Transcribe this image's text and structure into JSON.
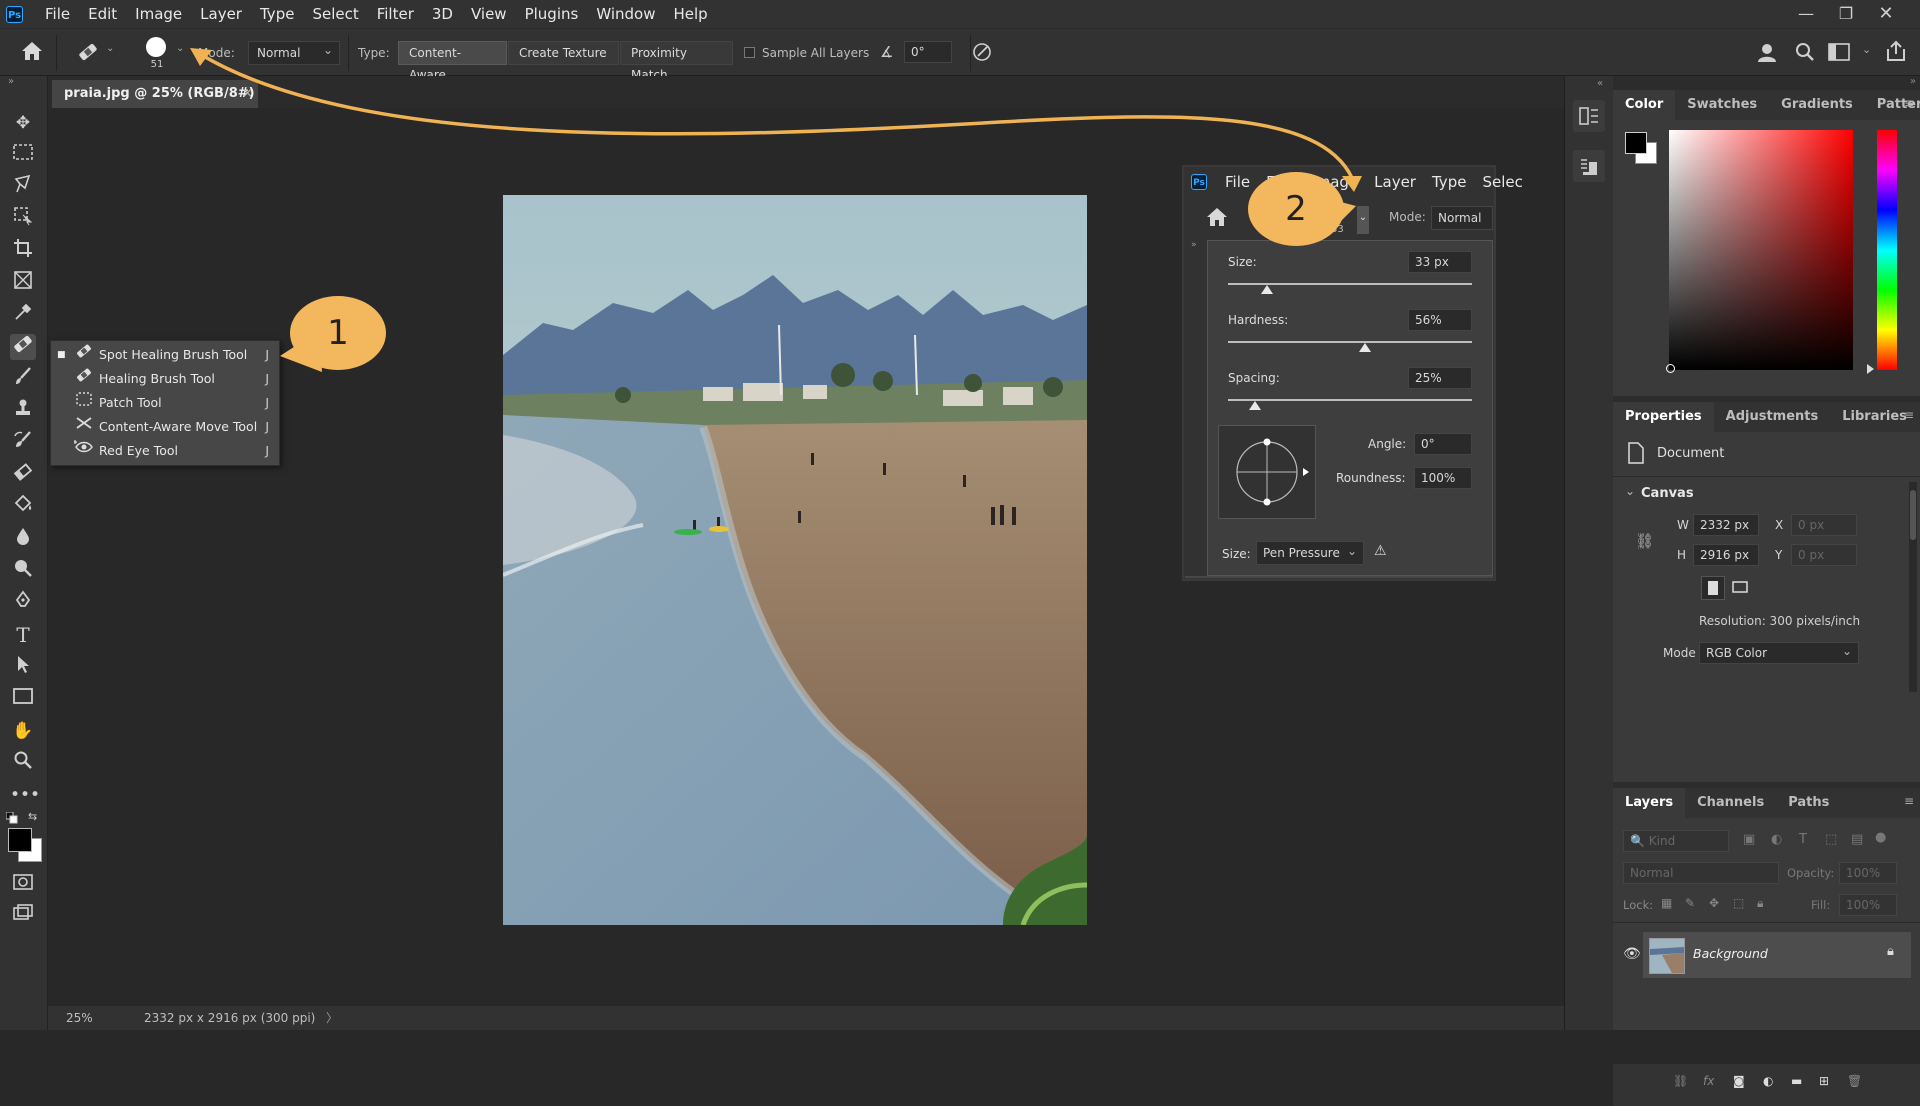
{
  "menubar": {
    "logo": "Ps",
    "items": [
      "File",
      "Edit",
      "Image",
      "Layer",
      "Type",
      "Select",
      "Filter",
      "3D",
      "View",
      "Plugins",
      "Window",
      "Help"
    ]
  },
  "options": {
    "brush_size": "51",
    "mode_label": "Mode:",
    "mode_value": "Normal",
    "type_label": "Type:",
    "type_buttons": [
      "Content-Aware",
      "Create Texture",
      "Proximity Match"
    ],
    "sample_all_layers": "Sample All Layers",
    "angle_value": "0°"
  },
  "document": {
    "tab_title": "praia.jpg @ 25% (RGB/8#)",
    "zoom": "25%",
    "info": "2332 px x 2916 px (300 ppi)"
  },
  "flyout": [
    {
      "label": "Spot Healing Brush Tool",
      "shortcut": "J",
      "icon": "spot-healing-brush-icon"
    },
    {
      "label": "Healing Brush Tool",
      "shortcut": "J",
      "icon": "healing-brush-icon"
    },
    {
      "label": "Patch Tool",
      "shortcut": "J",
      "icon": "patch-icon"
    },
    {
      "label": "Content-Aware Move Tool",
      "shortcut": "J",
      "icon": "content-aware-move-icon"
    },
    {
      "label": "Red Eye Tool",
      "shortcut": "J",
      "icon": "red-eye-icon"
    }
  ],
  "callouts": {
    "one": "1",
    "two": "2"
  },
  "inset": {
    "menu": [
      "File",
      "Edit",
      "Image",
      "Layer",
      "Type",
      "Selec"
    ],
    "size_small": "33",
    "mode_label": "Mode:",
    "mode_value": "Normal",
    "size_label": "Size:",
    "size_value": "33 px",
    "hardness_label": "Hardness:",
    "hardness_value": "56%",
    "spacing_label": "Spacing:",
    "spacing_value": "25%",
    "angle_label": "Angle:",
    "angle_value": "0°",
    "roundness_label": "Roundness:",
    "roundness_value": "100%",
    "pen_label": "Size:",
    "pen_value": "Pen Pressure",
    "size_level": 0.16,
    "hardness_level": 0.56,
    "spacing_level": 0.11
  },
  "color_panel": {
    "tabs": [
      "Color",
      "Swatches",
      "Gradients",
      "Patterns"
    ],
    "foreground": "#000000",
    "background": "#ffffff",
    "hue_color": "#ff0000"
  },
  "properties": {
    "tabs": [
      "Properties",
      "Adjustments",
      "Libraries"
    ],
    "doc_label": "Document",
    "canvas_label": "Canvas",
    "w_label": "W",
    "w_value": "2332 px",
    "h_label": "H",
    "h_value": "2916 px",
    "x_label": "X",
    "x_value": "0 px",
    "y_label": "Y",
    "y_value": "0 px",
    "resolution": "Resolution: 300 pixels/inch",
    "mode_label": "Mode",
    "mode_value": "RGB Color"
  },
  "layers": {
    "tabs": [
      "Layers",
      "Channels",
      "Paths"
    ],
    "kind": "Kind",
    "blend": "Normal",
    "opacity_label": "Opacity:",
    "opacity_value": "100%",
    "lock_label": "Lock:",
    "fill_label": "Fill:",
    "fill_value": "100%",
    "layer_name": "Background"
  }
}
